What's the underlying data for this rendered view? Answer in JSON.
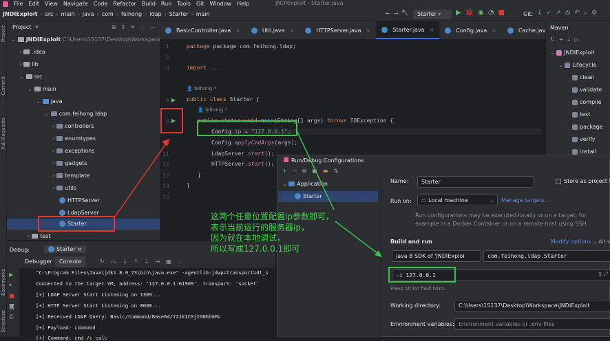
{
  "app": {
    "icon": "intellij-icon",
    "menus": [
      "File",
      "Edit",
      "View",
      "Navigate",
      "Code",
      "Refactor",
      "Build",
      "Run",
      "Tools",
      "Git",
      "Window",
      "Help"
    ],
    "window_title": "JNDIExploit - Starter.java"
  },
  "nav": {
    "crumbs": [
      "JNDIExploit",
      "src",
      "main",
      "java",
      "com",
      "feihong",
      "ldap",
      "Starter",
      "main"
    ],
    "run_config": "Starter",
    "git_label": "Git:"
  },
  "project": {
    "header": "Project",
    "root": "JNDIExploit",
    "root_path": "C:\\Users\\15137\\Desktop\\Workspace\\JNDIE",
    "items": [
      ".idea",
      "lib",
      "src",
      "main",
      "java",
      "com.feihong.ldap",
      "controllers",
      "enumtypes",
      "exceptions",
      "gadgets",
      "template",
      "utils",
      "HTTPServer",
      "LdapServer",
      "Starter",
      "test"
    ]
  },
  "tabs": [
    "BasicController.java",
    "Util.java",
    "HTTPServer.java",
    "Starter.java",
    "Config.java",
    "Cache.java"
  ],
  "editor": {
    "line_numbers": [
      "1",
      "2",
      "3",
      "",
      "6",
      "",
      "8",
      "",
      "10",
      "11",
      "12",
      "13",
      "14",
      "15"
    ],
    "lines": {
      "l1": "package com.feihong.ldap;",
      "l3": "import ...",
      "author1": "feihong *",
      "l6a": "public class ",
      "l6b": "Starter {",
      "author2": "feihong *",
      "l8a": "public static void ",
      "l8b": "main",
      "l8c": "(String[] args) ",
      "l8d": "throws ",
      "l8e": "IOException {",
      "l9a": "Config.",
      "l9b": "ip",
      "l9c": " = ",
      "l9d": "\"127.0.0.1\"",
      "l9e": ";",
      "l10a": "Config.",
      "l10b": "applyCmdArgs",
      "l10c": "(args);",
      "l11a": "LdapServer.",
      "l11b": "start",
      "l11c": "();",
      "l12a": "HTTPServer.",
      "l12b": "start",
      "l12c": "();",
      "l13": "}",
      "l14": "}"
    }
  },
  "maven": {
    "title": "Maven",
    "project": "JNDIExploit",
    "lifecycle": "Lifecycle",
    "goals": [
      "clean",
      "validate",
      "compile",
      "test",
      "package",
      "verify",
      "install"
    ]
  },
  "debug": {
    "label": "Debug:",
    "session": "Starter",
    "tabs": [
      "Debugger",
      "Console"
    ],
    "console": [
      "\"C:\\Program Files\\Java\\jdk1.8.0_73\\bin\\java.exe\" -agentlib:jdwp=transport=dt_s",
      "Connected to the target VM, address: '127.0.0.1:61909', transport: 'socket'",
      "[+] LDAP Server Start Listening on 1389...",
      "[+] HTTP Server Start Listening on 8080...",
      "[+] Received LDAP Query: Basic/Command/Base64/Y21kIC9jIGNhbGM=",
      "[+] Payload: command",
      "[+] Command: cmd /c calc"
    ]
  },
  "dialog": {
    "title": "Run/Debug Configurations",
    "tree_group": "Application",
    "tree_item": "Starter",
    "name_label": "Name:",
    "name_value": "Starter",
    "store_label": "Store as project fil",
    "run_on_label": "Run on:",
    "run_on_value": "Local machine",
    "manage_targets": "Manage targets...",
    "run_on_desc1": "Run configurations may be executed locally or on a target: for",
    "run_on_desc2": "example in a Docker Container or on a remote host using SSH.",
    "build_run": "Build and run",
    "modify_options": "Modify options",
    "alt_hint": "Alt+",
    "jdk_value": "java 8  SDK of 'JNDIExploi",
    "main_class": "com.feihong.ldap.Starter",
    "program_args": "-i 127.0.0.1",
    "field_hint": "Press Alt for field hints",
    "workdir_label": "Working directory:",
    "workdir_value": "C:\\Users\\15137\\Desktop\\Workspace\\JNDIExploit",
    "env_label": "Environment variables:",
    "env_placeholder": "Environment variables or .env files"
  },
  "annotation": [
    "这两个任意位置配置ip参数即可，",
    "表示当前运行的服务器ip，",
    "因为就在本地调试，",
    "所以写成127.0.0.1即可"
  ],
  "colors": {
    "accent": "#3574f0",
    "annotation_red": "#e2362e",
    "annotation_green": "#3bc14a"
  }
}
